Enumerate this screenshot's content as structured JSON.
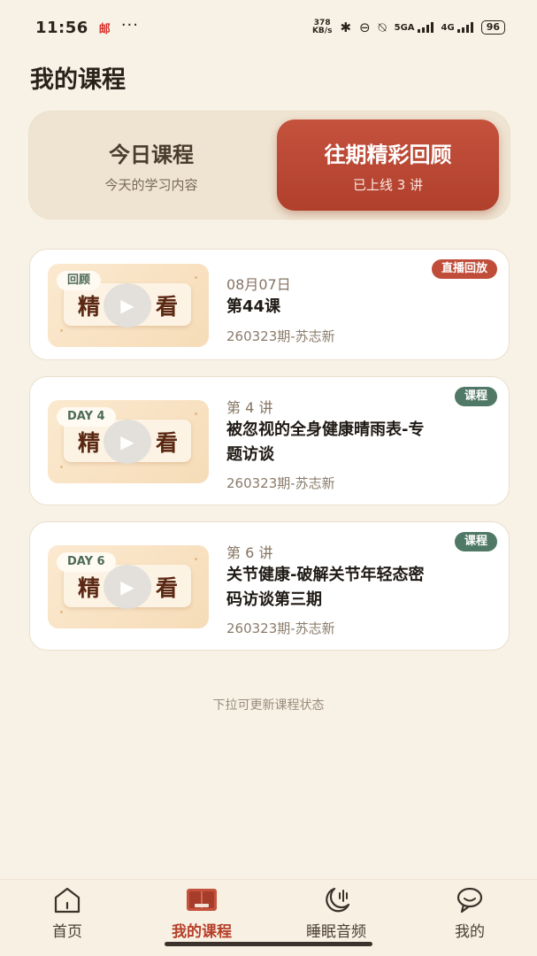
{
  "status_bar": {
    "time": "11:56",
    "mail_icon_text": "邮",
    "more": "···",
    "speed_value": "378",
    "speed_unit": "KB/s",
    "net1": "5GA",
    "net2": "4G",
    "battery": "96"
  },
  "page_title": "我的课程",
  "tabs": {
    "today": {
      "label": "今日课程",
      "subtitle": "今天的学习内容"
    },
    "past": {
      "label": "往期精彩回顾",
      "subtitle": "已上线 3 讲"
    }
  },
  "thumb_text": {
    "left": "精",
    "right": "看"
  },
  "cards": [
    {
      "thumb_tag": "回顾",
      "meta": "08月07日",
      "title": "第44课",
      "subtitle": "260323期-苏志新",
      "badge": "直播回放",
      "badge_color": "#c04d39"
    },
    {
      "thumb_tag": "DAY 4",
      "meta": "第 4 讲",
      "title": "被忽视的全身健康晴雨表-专题访谈",
      "subtitle": "260323期-苏志新",
      "badge": "课程",
      "badge_color": "#4f7866"
    },
    {
      "thumb_tag": "DAY 6",
      "meta": "第 6 讲",
      "title": "关节健康-破解关节年轻态密码访谈第三期",
      "subtitle": "260323期-苏志新",
      "badge": "课程",
      "badge_color": "#4f7866"
    }
  ],
  "hint": "下拉可更新课程状态",
  "nav": [
    {
      "label": "首页",
      "icon": "home-icon"
    },
    {
      "label": "我的课程",
      "icon": "book-icon"
    },
    {
      "label": "睡眠音频",
      "icon": "moon-sound-icon"
    },
    {
      "label": "我的",
      "icon": "profile-chat-icon"
    }
  ],
  "colors": {
    "accent": "#b53f2a",
    "background": "#f8f2e6",
    "badge_green": "#4f7866"
  }
}
